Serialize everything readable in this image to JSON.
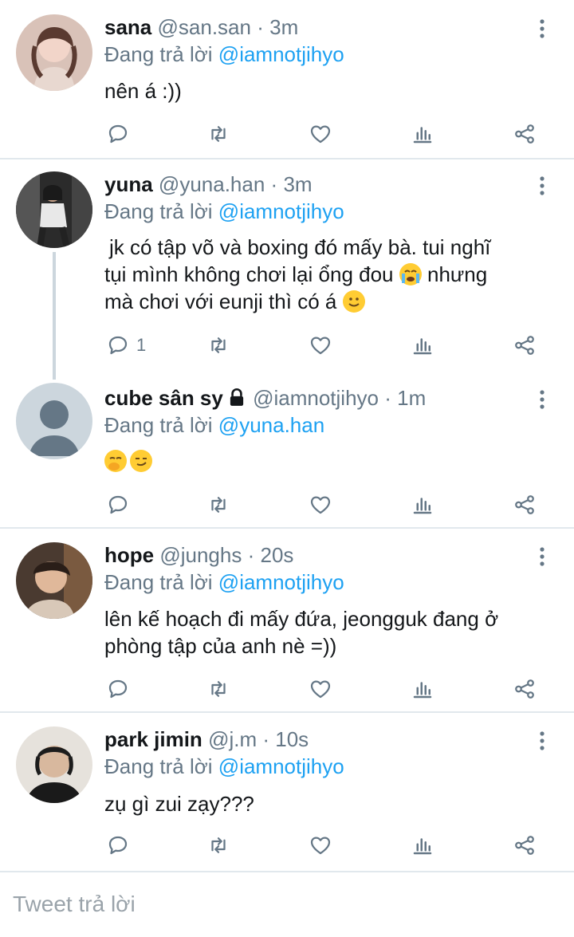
{
  "replying_prefix": "Đang trả lời",
  "tweets": [
    {
      "name": "sana",
      "handle": "@san.san",
      "time": "3m",
      "reply_to": "@iamnotjihyo",
      "text": "nên á :))",
      "reply_count": ""
    },
    {
      "name": "yuna",
      "handle": "@yuna.han",
      "time": "3m",
      "reply_to": "@iamnotjihyo",
      "text_line1": "jk có tập võ và boxing đó mấy bà. tui nghĩ",
      "text_line2": "tụi mình không chơi lại ổng đou",
      "text_line2b": "nhưng",
      "text_line3": "mà chơi với eunji thì có á",
      "reply_count": "1"
    },
    {
      "name": "cube sân sy",
      "handle": "@iamnotjihyo",
      "time": "1m",
      "reply_to": "@yuna.han",
      "text": "",
      "reply_count": ""
    },
    {
      "name": "hope",
      "handle": "@junghs",
      "time": "20s",
      "reply_to": "@iamnotjihyo",
      "text_line1": "lên kế hoạch đi mấy đứa, jeongguk đang ở",
      "text_line2": "phòng tập của anh nè =))",
      "reply_count": ""
    },
    {
      "name": "park jimin",
      "handle": "@j.m",
      "time": "10s",
      "reply_to": "@iamnotjihyo",
      "text": "zụ gì zui zạy???",
      "reply_count": ""
    }
  ],
  "composer": {
    "placeholder": "Tweet trả lời"
  },
  "icons": {
    "reply": "reply-icon",
    "retweet": "retweet-icon",
    "like": "heart-icon",
    "stats": "stats-icon",
    "share": "share-icon",
    "menu": "more-vertical-icon",
    "lock": "lock-icon"
  },
  "colors": {
    "accent": "#1da1f2",
    "muted": "#657786",
    "text": "#14171a",
    "divider": "#e1e8ed"
  }
}
